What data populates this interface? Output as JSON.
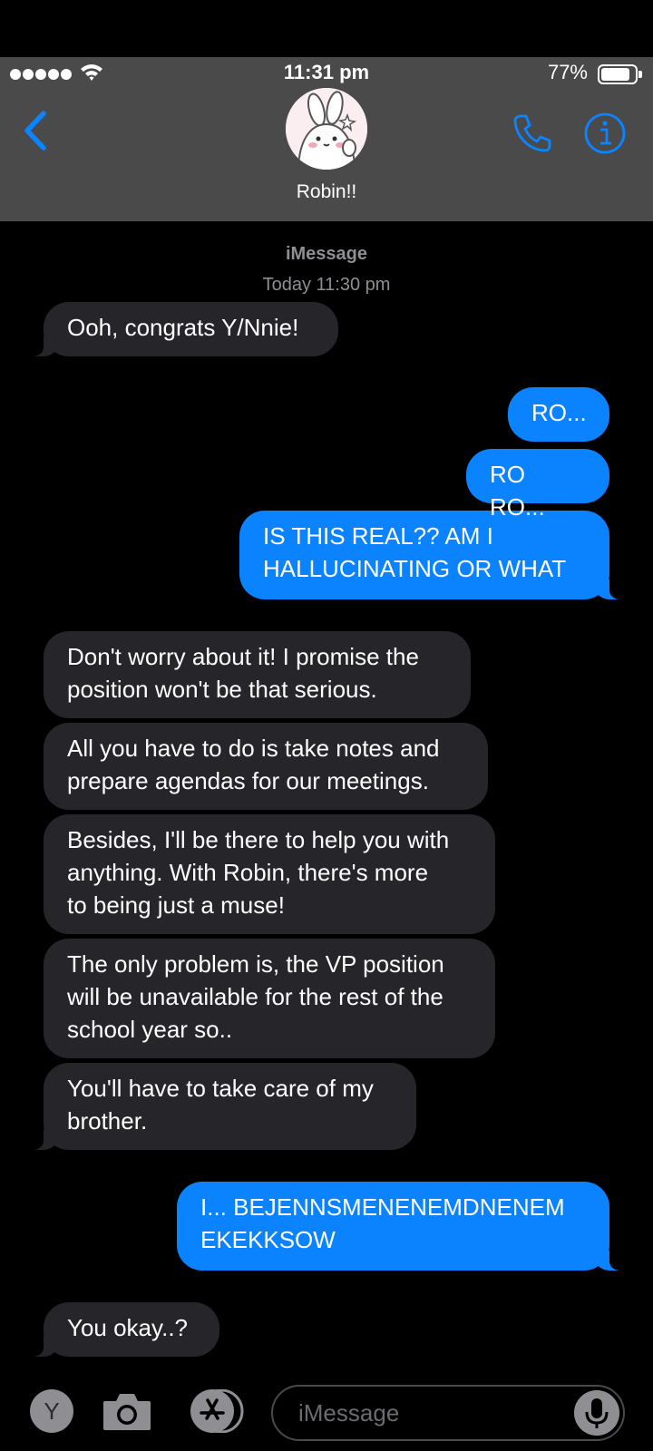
{
  "status_bar": {
    "time": "11:31 pm",
    "battery": "77%",
    "battery_level": 0.77
  },
  "header": {
    "contact_name": "Robin!!"
  },
  "thread": {
    "service": "iMessage",
    "timestamp": "Today 11:30 pm",
    "messages": [
      {
        "from": "them",
        "lines": [
          "Ooh, congrats Y/Nnie!"
        ]
      },
      {
        "from": "me",
        "lines": [
          "RO..."
        ]
      },
      {
        "from": "me",
        "lines": [
          "RO RO..."
        ]
      },
      {
        "from": "me",
        "lines": [
          "IS THIS REAL?? AM I",
          "HALLUCINATING OR WHAT"
        ]
      },
      {
        "from": "them",
        "lines": [
          "Don't worry about it! I promise the",
          "position won't be that serious."
        ]
      },
      {
        "from": "them",
        "lines": [
          "All you have to do is take notes and",
          "prepare agendas for our meetings."
        ]
      },
      {
        "from": "them",
        "lines": [
          "Besides, I'll be there to help you with",
          "anything. With Robin, there's more",
          "to being just a muse!"
        ]
      },
      {
        "from": "them",
        "lines": [
          "The only problem is, the VP position",
          "will be unavailable for the rest of the",
          "school year so.."
        ]
      },
      {
        "from": "them",
        "lines": [
          "You'll have to take care of my",
          "brother."
        ]
      },
      {
        "from": "me",
        "lines": [
          "I... BEJENNSMENENEMDNENEM",
          "EKEKKSOW"
        ]
      },
      {
        "from": "them",
        "lines": [
          "You okay..?"
        ]
      }
    ]
  },
  "input_bar": {
    "app_initial": "Y",
    "placeholder": "iMessage"
  },
  "colors": {
    "sent": "#0b82fe",
    "received": "#26252a",
    "header": "#4a4a4b",
    "accent": "#0a84ff"
  },
  "icons": [
    "back-chevron-icon",
    "phone-icon",
    "info-icon",
    "camera-icon",
    "app-store-icon",
    "microphone-icon",
    "wifi-icon",
    "battery-icon"
  ]
}
